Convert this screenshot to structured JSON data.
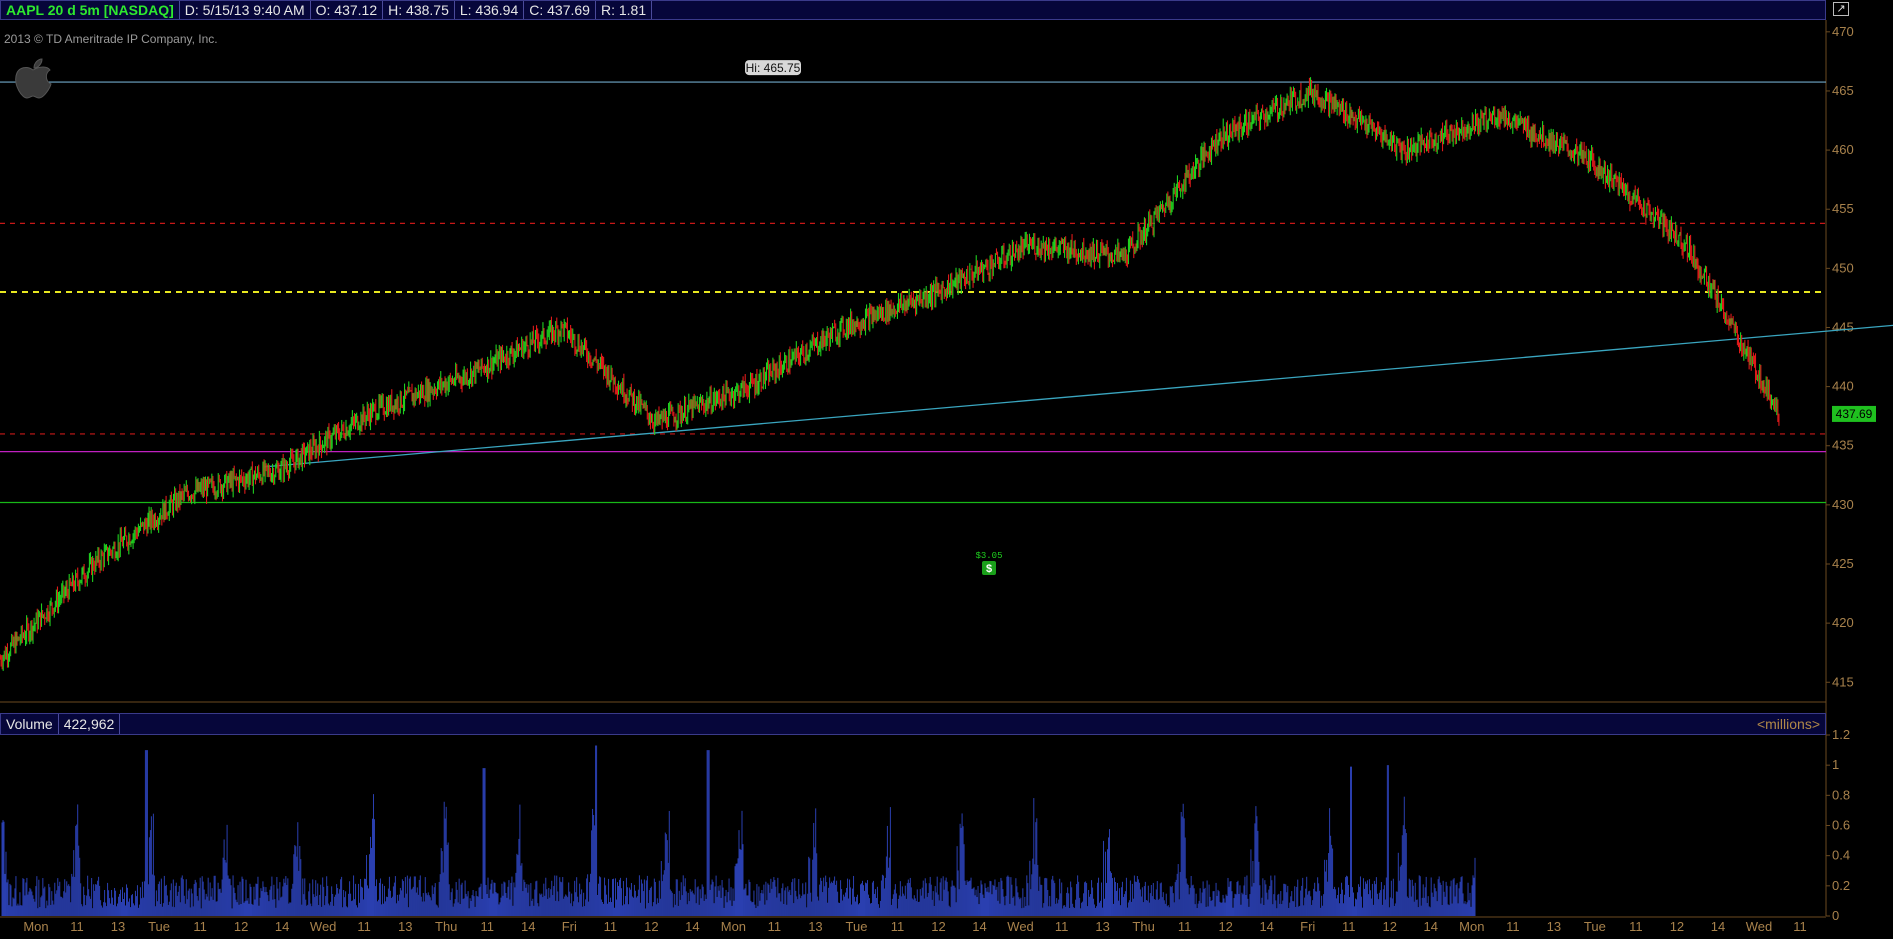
{
  "header": {
    "symbol": "AAPL 20 d 5m [NASDAQ]",
    "date": "D: 5/15/13 9:40 AM",
    "open": "O: 437.12",
    "high": "H: 438.75",
    "low": "L: 436.94",
    "close": "C: 437.69",
    "range": "R: 1.81"
  },
  "copyright": "2013 © TD Ameritrade IP Company, Inc.",
  "icons": {
    "corner": "expand-icon",
    "logo": "apple-logo"
  },
  "volume_header": {
    "label": "Volume",
    "value": "422,962",
    "unit": "<millions>"
  },
  "annotations": {
    "hi_label": "Hi: 465.75",
    "last_price": "437.69",
    "dividend_amount": "$3.05",
    "dividend_symbol": "$"
  },
  "colors": {
    "up": "#1fd01f",
    "down": "#e01a1a",
    "volume": "#2a3fb0",
    "resistance_blue": "#6fa8c8",
    "red_dash": "#c81818",
    "yellow_dash": "#e8e820",
    "magenta": "#c020c0",
    "green_line": "#18b818",
    "trendline": "#3aa6c0",
    "axis_text": "#a8824c"
  },
  "chart_data": [
    {
      "type": "line",
      "subtype": "candlestick-approximation",
      "series": [
        {
          "x": [
            0,
            1,
            2,
            3,
            4,
            5,
            6,
            7,
            8,
            9,
            10,
            11,
            12,
            13,
            14,
            15,
            16,
            17,
            18,
            19
          ],
          "y": [
            417,
            425,
            431,
            433,
            438,
            441,
            445,
            437,
            440,
            445,
            448,
            452,
            451,
            461,
            465,
            460,
            463,
            459,
            452,
            437.7
          ]
        }
      ],
      "y_ticks": [
        415,
        420,
        425,
        430,
        435,
        440,
        445,
        450,
        455,
        460,
        465,
        470
      ],
      "ylim": [
        413.5,
        471
      ],
      "x_ticks": [
        "Mon",
        "11",
        "13",
        "Tue",
        "11",
        "12",
        "14",
        "Wed",
        "11",
        "13",
        "Thu",
        "11",
        "14",
        "Fri",
        "11",
        "12",
        "14",
        "Mon",
        "11",
        "13",
        "Tue",
        "11",
        "12",
        "14",
        "Wed",
        "11",
        "13",
        "Thu",
        "11",
        "12",
        "14",
        "Fri",
        "11",
        "12",
        "14",
        "Mon",
        "11",
        "13",
        "Tue",
        "11",
        "12",
        "14",
        "Wed",
        "11"
      ],
      "horizontal_lines": [
        {
          "value": 465.75,
          "style": "solid",
          "color": "resistance_blue"
        },
        {
          "value": 453.8,
          "style": "dashed",
          "color": "red_dash"
        },
        {
          "value": 448.0,
          "style": "dashed",
          "color": "yellow_dash"
        },
        {
          "value": 436.0,
          "style": "dashed",
          "color": "red_dash"
        },
        {
          "value": 434.5,
          "style": "solid",
          "color": "magenta"
        },
        {
          "value": 430.2,
          "style": "solid",
          "color": "green_line"
        }
      ],
      "trendline": {
        "from": [
          0.1,
          433.2
        ],
        "to": [
          1.0,
          445.2
        ]
      },
      "last_price": 437.69,
      "high": 465.75
    },
    {
      "type": "bar",
      "name": "Volume",
      "y_ticks": [
        0,
        0.2,
        0.4,
        0.6,
        0.8,
        1,
        1.2
      ],
      "ylim": [
        0,
        1.2
      ],
      "spikes": [
        {
          "x": 0.098,
          "value": 1.1
        },
        {
          "x": 0.327,
          "value": 0.98
        },
        {
          "x": 0.403,
          "value": 1.13
        },
        {
          "x": 0.479,
          "value": 1.1
        },
        {
          "x": 0.915,
          "value": 0.99
        },
        {
          "x": 0.94,
          "value": 1.0
        }
      ]
    }
  ]
}
